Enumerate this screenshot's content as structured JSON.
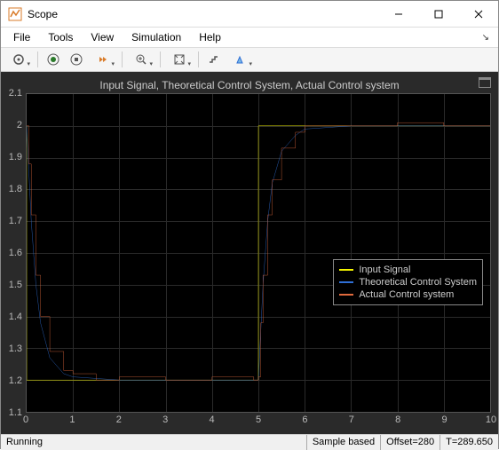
{
  "window": {
    "title": "Scope"
  },
  "menubar": {
    "items": [
      "File",
      "Tools",
      "View",
      "Simulation",
      "Help"
    ]
  },
  "toolbar": {
    "icons": [
      "gear-icon",
      "run-icon",
      "stop-icon",
      "step-forward-icon",
      "zoom-icon",
      "autoscale-icon",
      "stairs-icon",
      "highlight-icon"
    ]
  },
  "plot": {
    "title": "Input Signal, Theoretical Control System, Actual Control system",
    "x_ticks": [
      "0",
      "1",
      "2",
      "3",
      "4",
      "5",
      "6",
      "7",
      "8",
      "9",
      "10"
    ],
    "y_ticks": [
      "1.1",
      "1.2",
      "1.3",
      "1.4",
      "1.5",
      "1.6",
      "1.7",
      "1.8",
      "1.9",
      "2",
      "2.1"
    ]
  },
  "legend": {
    "items": [
      {
        "label": "Input Signal",
        "color": "#f5f500"
      },
      {
        "label": "Theoretical Control System",
        "color": "#2f6fd6"
      },
      {
        "label": "Actual Control system",
        "color": "#e06a3d"
      }
    ]
  },
  "status": {
    "left": "Running",
    "mode": "Sample based",
    "offset": "Offset=280",
    "time": "T=289.650"
  },
  "chart_data": {
    "type": "line",
    "title": "Input Signal, Theoretical Control System, Actual Control system",
    "xlabel": "",
    "ylabel": "",
    "xlim": [
      0,
      10
    ],
    "ylim": [
      1.1,
      2.1
    ],
    "series": [
      {
        "name": "Input Signal",
        "color": "#f5f500",
        "x": [
          0,
          0.001,
          5,
          5.001,
          10
        ],
        "y": [
          2.0,
          1.2,
          1.2,
          2.0,
          2.0
        ]
      },
      {
        "name": "Theoretical Control System",
        "color": "#2f6fd6",
        "x": [
          0,
          0.05,
          0.1,
          0.2,
          0.3,
          0.5,
          0.8,
          1.0,
          2.0,
          4.9,
          5.0,
          5.05,
          5.1,
          5.2,
          5.3,
          5.5,
          5.8,
          6.0,
          7.0,
          10.0
        ],
        "y": [
          2.0,
          1.85,
          1.7,
          1.5,
          1.38,
          1.27,
          1.22,
          1.21,
          1.2,
          1.2,
          1.2,
          1.35,
          1.5,
          1.7,
          1.82,
          1.92,
          1.97,
          1.99,
          2.0,
          2.0
        ]
      },
      {
        "name": "Actual Control system",
        "color": "#e06a3d",
        "x": [
          0,
          0.05,
          0.1,
          0.2,
          0.3,
          0.5,
          0.8,
          1.0,
          1.5,
          2.0,
          3.0,
          4.0,
          4.9,
          5.0,
          5.05,
          5.1,
          5.2,
          5.3,
          5.5,
          5.8,
          6.0,
          7.0,
          8.0,
          9.0,
          10.0
        ],
        "y": [
          2.0,
          1.88,
          1.72,
          1.53,
          1.4,
          1.29,
          1.23,
          1.22,
          1.2,
          1.21,
          1.2,
          1.21,
          1.2,
          1.21,
          1.38,
          1.53,
          1.72,
          1.83,
          1.93,
          1.98,
          2.0,
          2.0,
          2.01,
          2.0,
          2.0
        ]
      }
    ]
  }
}
